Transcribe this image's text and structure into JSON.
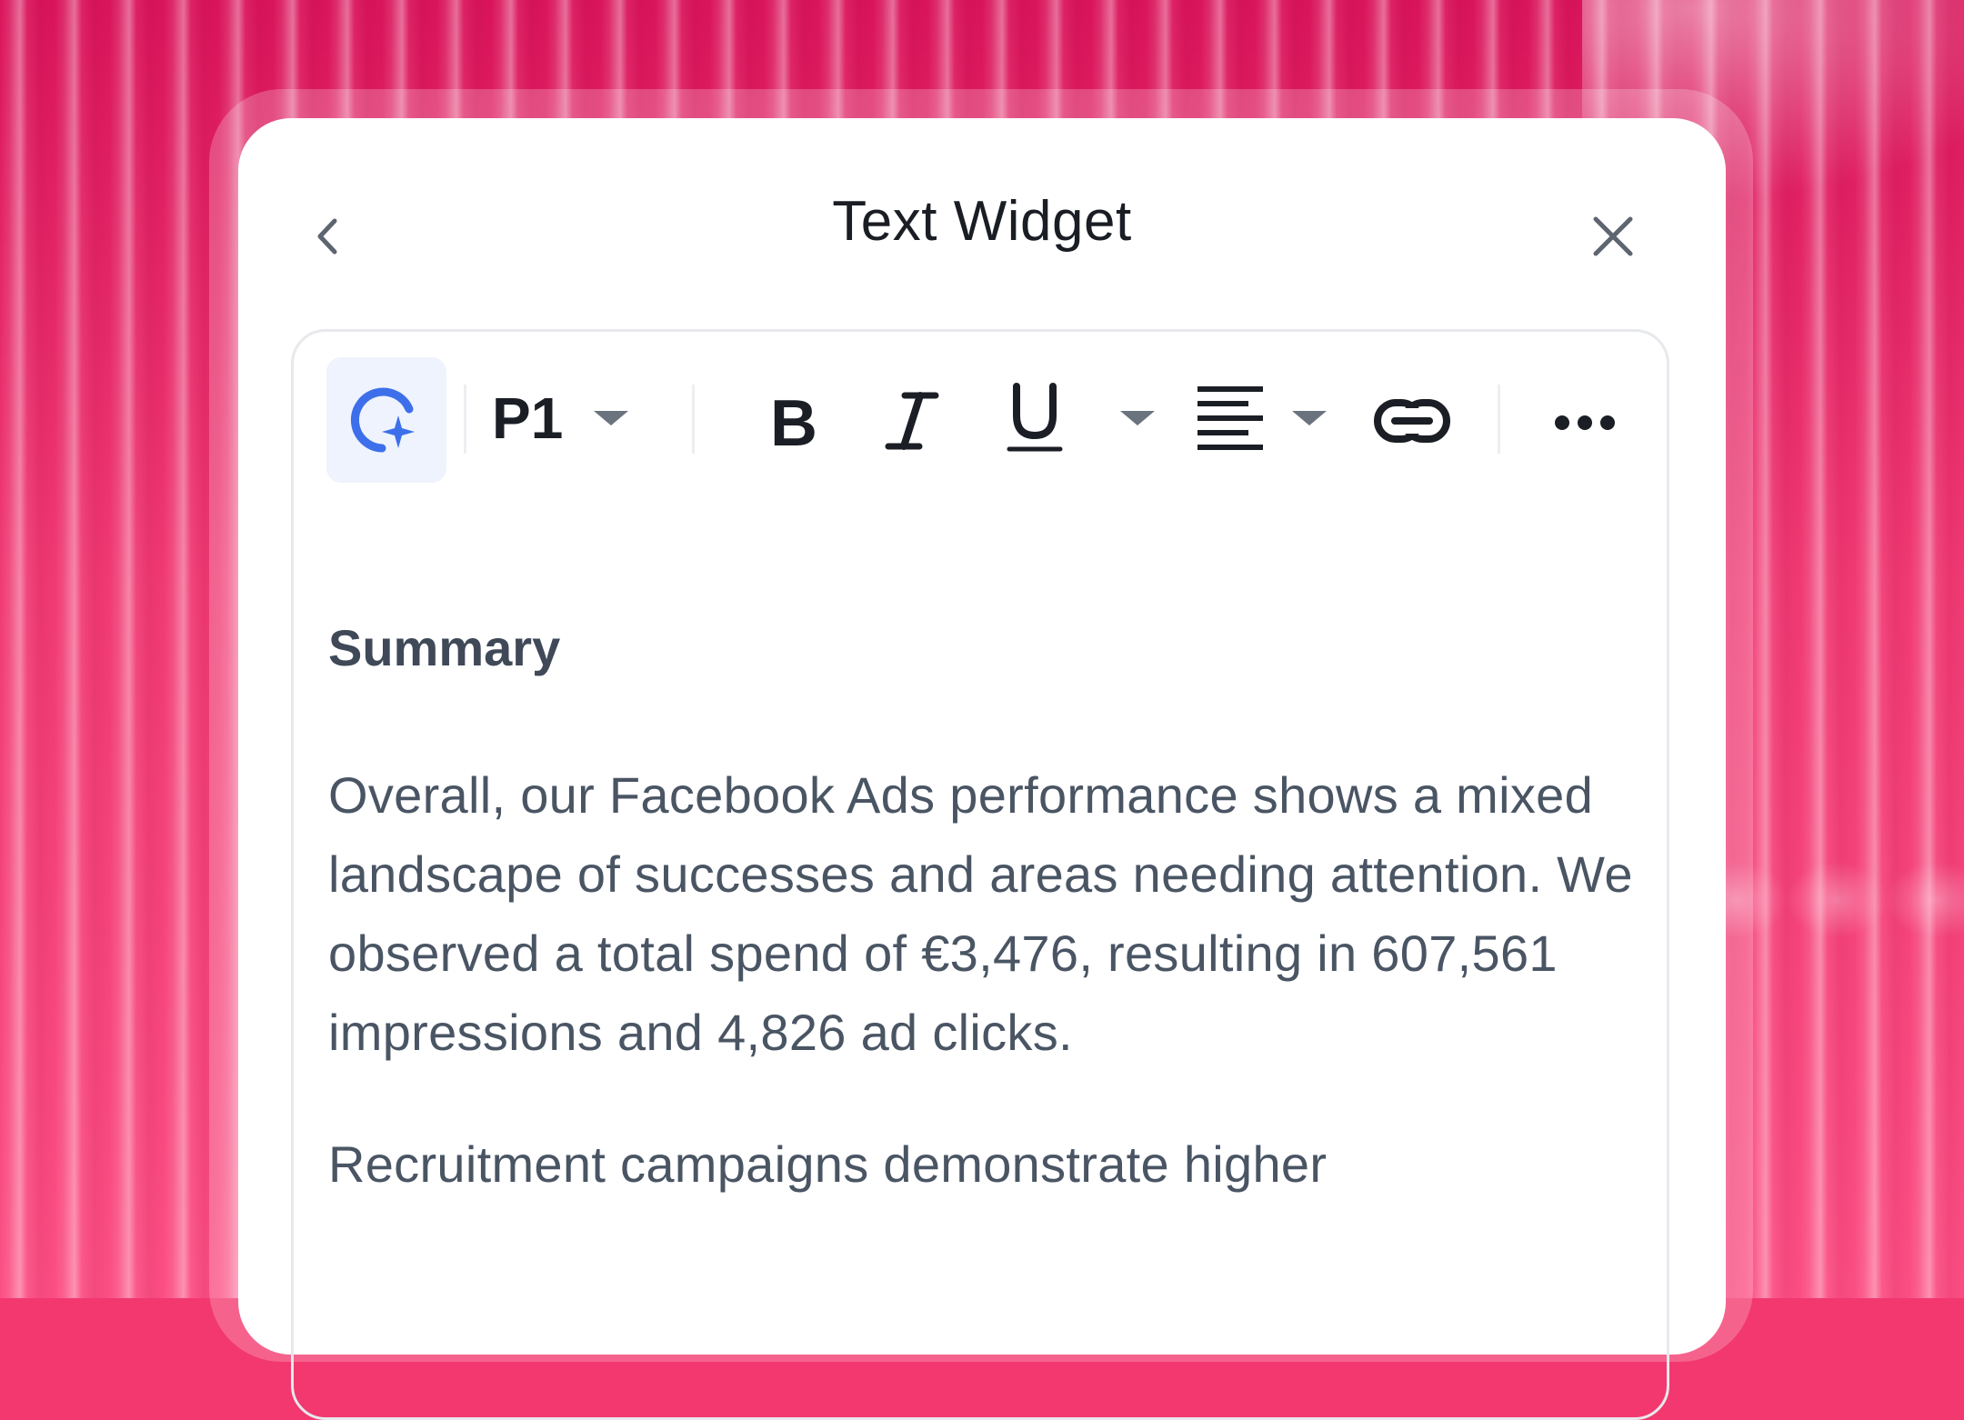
{
  "widget": {
    "title": "Text Widget"
  },
  "header": {
    "back_icon": "chevron-left-icon",
    "close_icon": "close-icon"
  },
  "toolbar": {
    "ai_icon": "ai-sparkle-icon",
    "paragraph_style": "P1",
    "bold_icon": "bold-icon",
    "italic_icon": "italic-icon",
    "underline_icon": "underline-icon",
    "align_icon": "align-left-icon",
    "link_icon": "link-icon",
    "more_icon": "more-horizontal-icon"
  },
  "content": {
    "heading": "Summary",
    "paragraph1": "Overall, our Facebook Ads performance shows a mixed landscape of successes and areas needing attention. We observed a total spend of €3,476, resulting in 607,561 impressions and 4,826 ad clicks.",
    "paragraph2": "Recruitment campaigns demonstrate higher"
  },
  "colors": {
    "background": "#f2386e",
    "card": "#ffffff",
    "ai_accent": "#3d6fea",
    "text_heading": "#3f4958",
    "text_body": "#4a5564"
  }
}
